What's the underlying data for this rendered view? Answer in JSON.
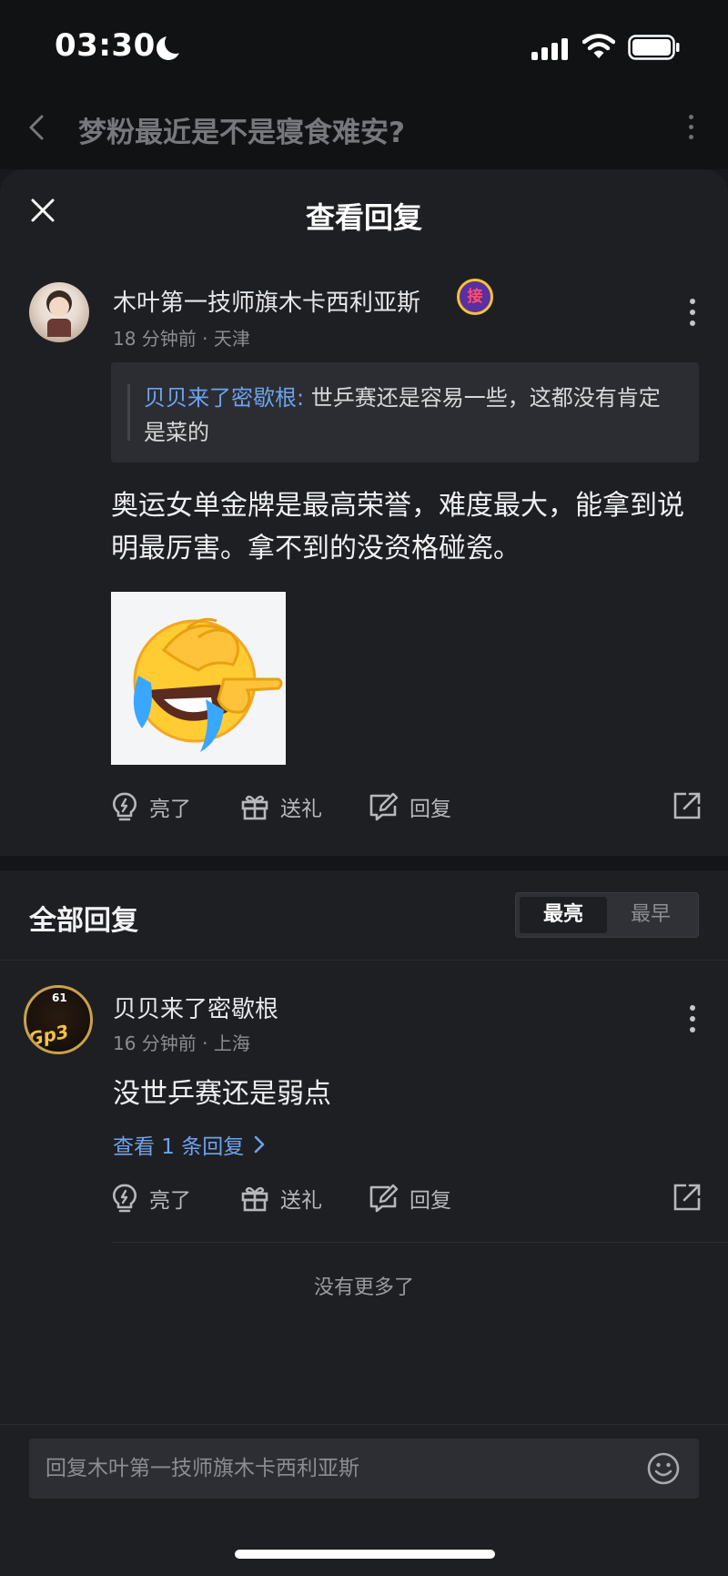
{
  "status_bar": {
    "time": "03:30"
  },
  "nav": {
    "title": "梦粉最近是不是寝食难安?"
  },
  "sheet": {
    "title": "查看回复"
  },
  "comment": {
    "author": "木叶第一技师旗木卡西利亚斯",
    "badge": "接",
    "time": "18 分钟前",
    "location": "天津",
    "quote_user": "贝贝来了密歇根:",
    "quote_text": " 世乒赛还是容易一些，这都没有肯定是菜的",
    "body": "奥运女单金牌是最高荣誉，难度最大，能拿到说明最厉害。拿不到的没资格碰瓷。",
    "actions": {
      "like": "亮了",
      "gift": "送礼",
      "reply": "回复"
    }
  },
  "replies_section": {
    "title": "全部回复",
    "sort_options": [
      "最亮",
      "最早"
    ],
    "active_sort": "最亮"
  },
  "reply": {
    "author": "贝贝来了密歇根",
    "avatar_number": "61",
    "avatar_tag": "Gp3",
    "time": "16 分钟前",
    "location": "上海",
    "body": "没世乒赛还是弱点",
    "view_more": "查看 1 条回复",
    "actions": {
      "like": "亮了",
      "gift": "送礼",
      "reply": "回复"
    }
  },
  "footer": {
    "no_more": "没有更多了"
  },
  "input": {
    "placeholder": "回复木叶第一技师旗木卡西利亚斯"
  },
  "colors": {
    "background": "#1e1f23",
    "link_blue": "#6ea3ee",
    "badge_purple": "#5a2fa0"
  },
  "icons": [
    "moon-icon",
    "signal-icon",
    "wifi-icon",
    "battery-icon",
    "back-icon",
    "more-icon",
    "close-icon",
    "lightbulb-icon",
    "gift-icon",
    "edit-icon",
    "share-icon",
    "chevron-right-icon",
    "smile-icon"
  ]
}
